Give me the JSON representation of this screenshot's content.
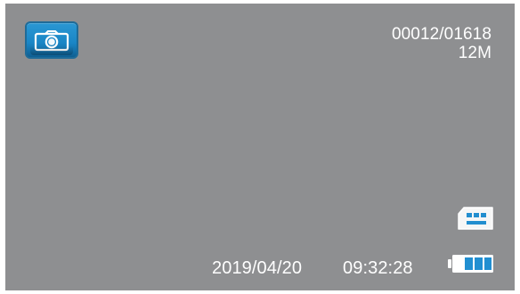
{
  "camera_ui": {
    "mode": {
      "label": "photo mode",
      "icon": "camera-icon",
      "accent_color": "#1a86c6"
    },
    "counter": {
      "shots": "00012/01618",
      "resolution": "12M"
    },
    "status": {
      "storage_icon": "sd-card-icon",
      "battery_icon": "battery-icon",
      "battery_level": 0.67
    },
    "timestamp": {
      "date": "2019/04/20",
      "time": "09:32:28"
    }
  }
}
